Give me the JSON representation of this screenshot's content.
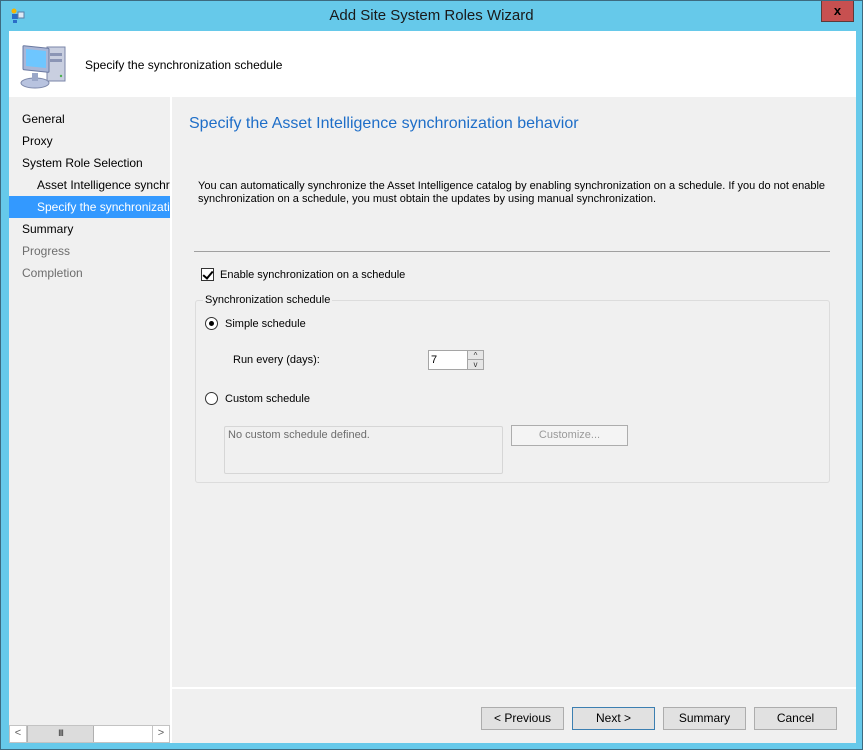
{
  "window": {
    "title": "Add Site System Roles Wizard",
    "close_label": "x",
    "icons": {
      "app": "wizard-app-icon",
      "close": "close-icon"
    }
  },
  "header": {
    "text": "Specify the synchronization schedule",
    "icon": "computer-icon"
  },
  "sidebar": {
    "items": [
      {
        "label": "General",
        "state": "normal"
      },
      {
        "label": "Proxy",
        "state": "normal"
      },
      {
        "label": "System Role Selection",
        "state": "normal"
      },
      {
        "label": "Asset Intelligence synchronization",
        "state": "sub"
      },
      {
        "label": "Specify the synchronization schedule",
        "state": "active"
      },
      {
        "label": "Summary",
        "state": "normal"
      },
      {
        "label": "Progress",
        "state": "disabled"
      },
      {
        "label": "Completion",
        "state": "disabled"
      }
    ],
    "scrollbar": {
      "left_glyph": "<",
      "right_glyph": ">",
      "thumb_glyph": "III"
    }
  },
  "main": {
    "title": "Specify the Asset Intelligence synchronization behavior",
    "description": "You can automatically synchronize the Asset Intelligence catalog by enabling synchronization on a schedule. If you do not enable synchronization on a schedule, you must obtain the updates by using manual synchronization.",
    "enable_checkbox": {
      "label": "Enable synchronization on a schedule",
      "checked": true
    },
    "group_label": "Synchronization schedule",
    "simple_schedule": {
      "label": "Simple schedule",
      "selected": true
    },
    "run_every": {
      "label": "Run every (days):",
      "value": "7"
    },
    "custom_schedule": {
      "label": "Custom schedule",
      "selected": false
    },
    "custom_text": "No custom schedule defined.",
    "customize_button": "Customize...",
    "spin_up_glyph": "^",
    "spin_down_glyph": "v"
  },
  "footer": {
    "previous": "< Previous",
    "next": "Next >",
    "summary": "Summary",
    "cancel": "Cancel"
  },
  "colors": {
    "title_bar": "#66c9ea",
    "close_button": "#c75050",
    "accent_title": "#1e6ec8",
    "selection": "#3399ff"
  }
}
